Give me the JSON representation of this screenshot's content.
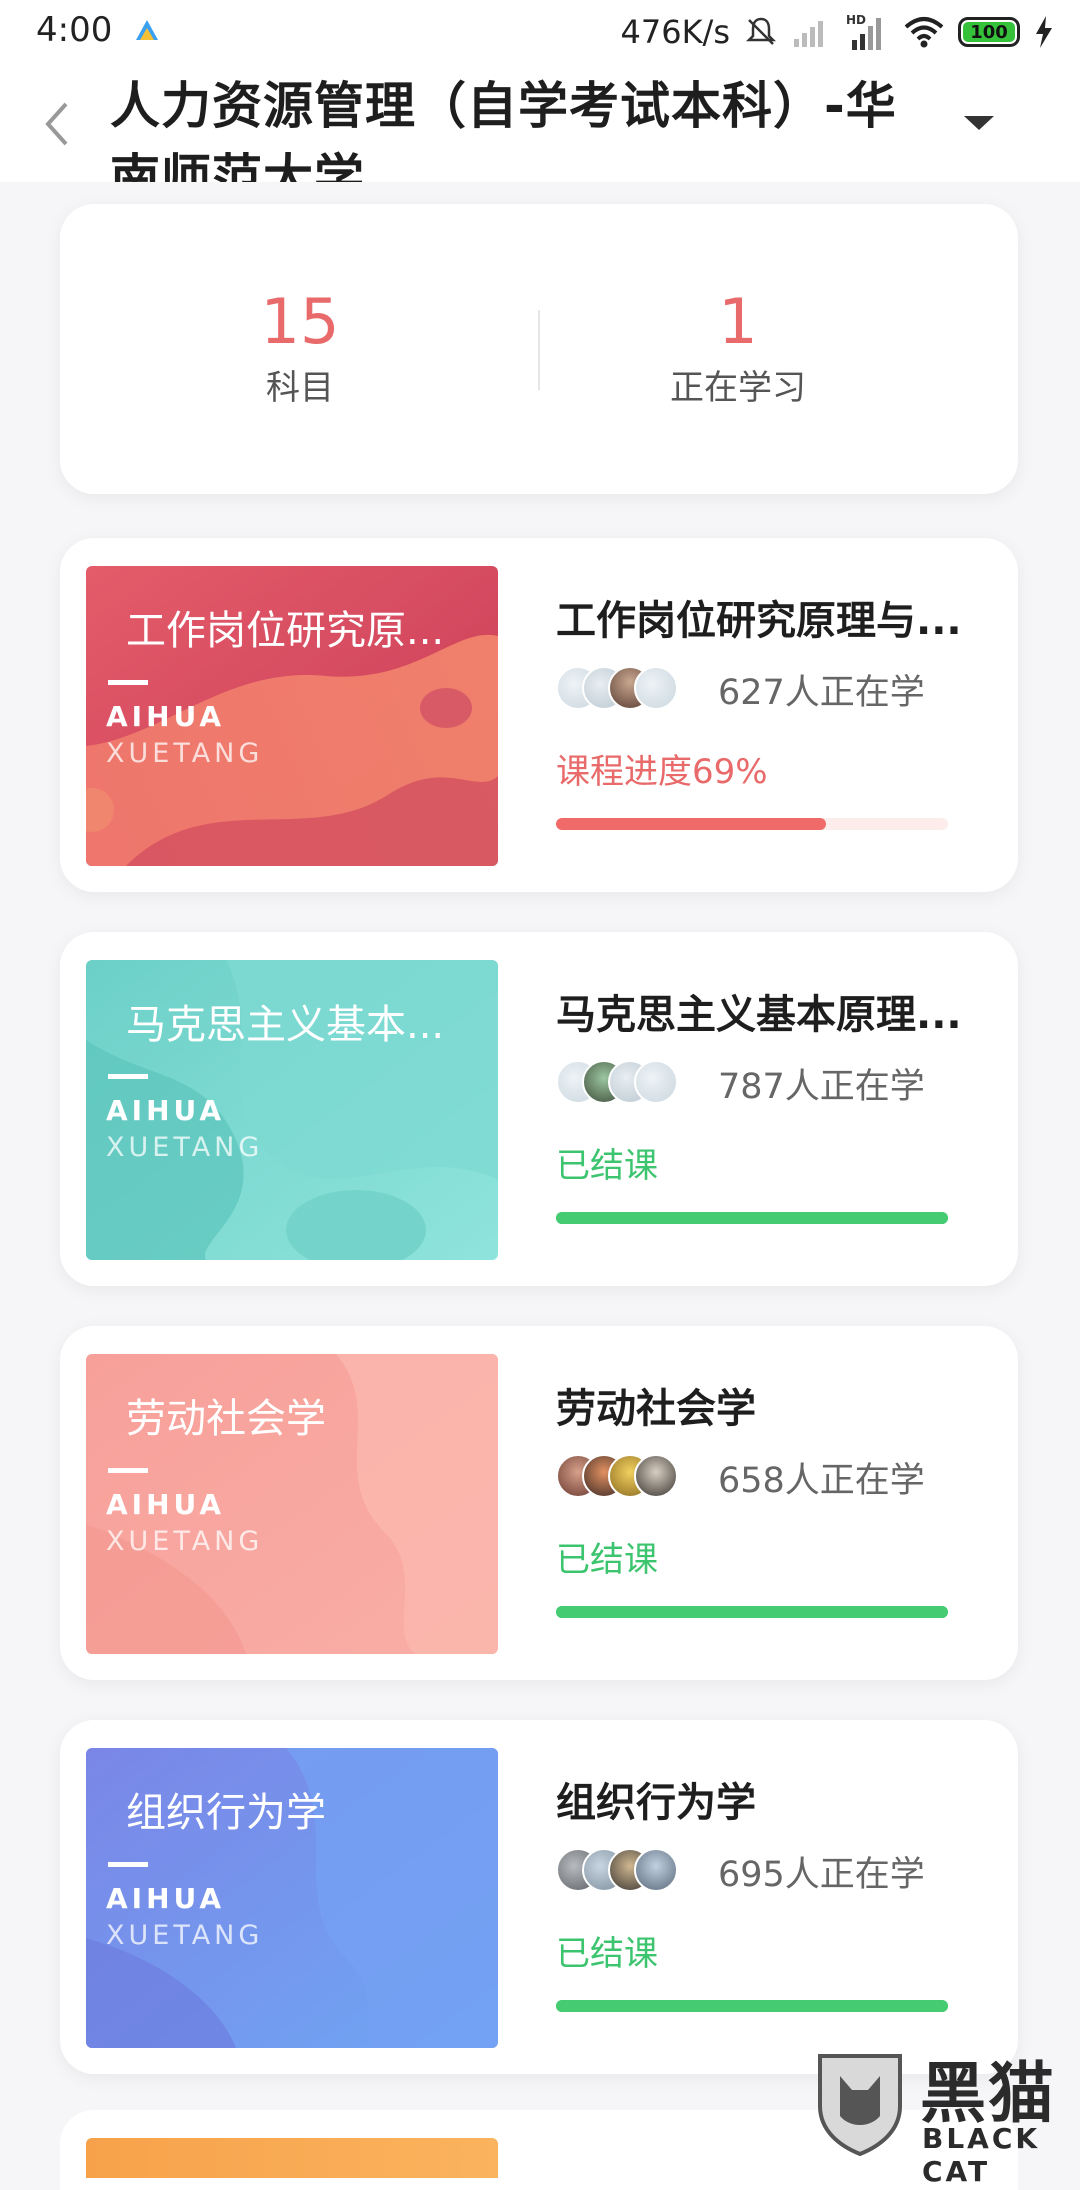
{
  "status_bar": {
    "time": "4:00",
    "net_speed": "476K/s",
    "battery": "100",
    "icons": [
      "app-icon",
      "mute-icon",
      "signal-icon",
      "hd-signal-icon",
      "wifi-icon",
      "battery-icon",
      "charging-icon"
    ]
  },
  "header": {
    "title": "人力资源管理（自学考试本科）-华南师范大学",
    "back_icon": "chevron-left-icon",
    "menu_icon": "triangle-down-icon"
  },
  "summary": {
    "subjects_count": "15",
    "subjects_label": "科目",
    "learning_count": "1",
    "learning_label": "正在学习"
  },
  "courses": [
    {
      "thumb_title": "工作岗位研究原...",
      "title": "工作岗位研究原理与...",
      "learners": "627人正在学",
      "status": "课程进度69%",
      "progress": 0.69,
      "status_color": "#e96a6a",
      "progress_color": "#f06a6a"
    },
    {
      "thumb_title": "马克思主义基本...",
      "title": "马克思主义基本原理...",
      "learners": "787人正在学",
      "status": "已结课",
      "progress": 1.0,
      "status_color": "#3cc46f",
      "progress_color": "#45cc73"
    },
    {
      "thumb_title": "劳动社会学",
      "title": "劳动社会学",
      "learners": "658人正在学",
      "status": "已结课",
      "progress": 1.0,
      "status_color": "#3cc46f",
      "progress_color": "#45cc73"
    },
    {
      "thumb_title": "组织行为学",
      "title": "组织行为学",
      "learners": "695人正在学",
      "status": "已结课",
      "progress": 1.0,
      "status_color": "#3cc46f",
      "progress_color": "#45cc73"
    }
  ],
  "thumb_brand": {
    "line1": "AIHUA",
    "line2": "XUETANG"
  },
  "watermark": {
    "cn": "黑猫",
    "en": "BLACK CAT"
  },
  "colors": {
    "accent_red": "#e96a6a",
    "success_green": "#3cc46f"
  }
}
